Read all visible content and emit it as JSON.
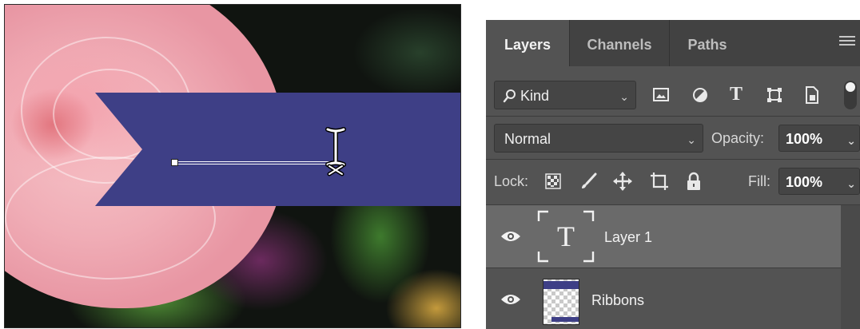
{
  "panel": {
    "tabs": [
      {
        "label": "Layers",
        "active": true
      },
      {
        "label": "Channels",
        "active": false
      },
      {
        "label": "Paths",
        "active": false
      }
    ],
    "filter": {
      "kind_label": "Kind",
      "icons": [
        "image-filter-icon",
        "adjustment-filter-icon",
        "type-filter-icon",
        "shape-filter-icon",
        "smart-object-filter-icon"
      ]
    },
    "blend_mode": "Normal",
    "opacity_label": "Opacity:",
    "opacity_value": "100%",
    "lock_label": "Lock:",
    "lock_icons": [
      "lock-transparent-icon",
      "lock-image-icon",
      "lock-position-icon",
      "lock-artboard-icon",
      "lock-all-icon"
    ],
    "fill_label": "Fill:",
    "fill_value": "100%",
    "layers": [
      {
        "name": "Layer 1",
        "type": "text",
        "visible": true,
        "selected": true,
        "thumb_glyph": "T"
      },
      {
        "name": "Ribbons",
        "type": "image",
        "visible": true,
        "selected": false
      }
    ]
  },
  "colors": {
    "panel_bg": "#535353",
    "tab_bar": "#424242",
    "selected_row": "#6a6a6a",
    "ribbon": "#3e3f86",
    "rose_pink": "#f3a2ad"
  }
}
